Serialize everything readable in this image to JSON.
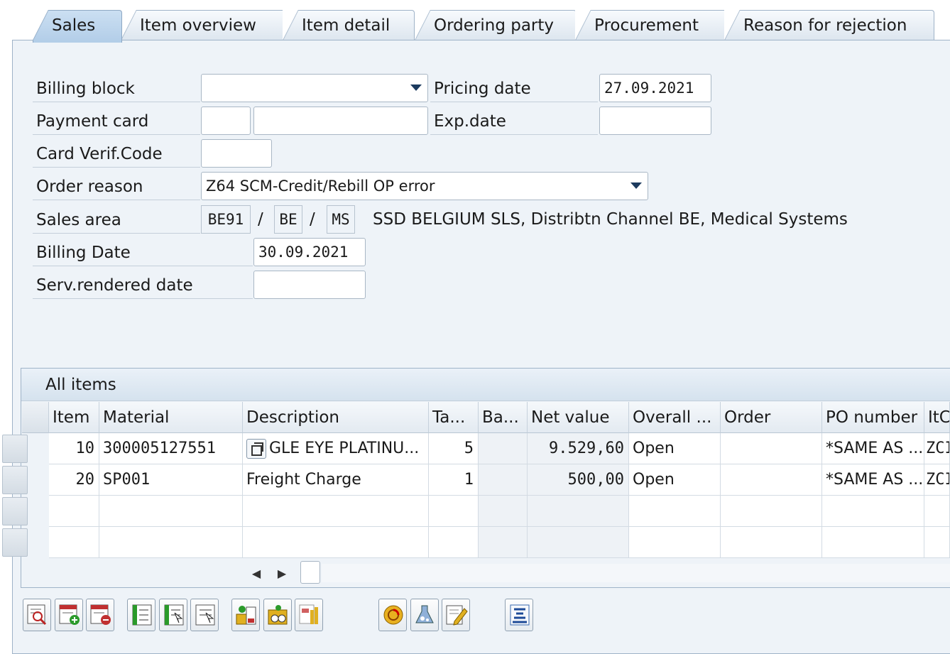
{
  "tabs": [
    {
      "label": "Sales",
      "active": true
    },
    {
      "label": "Item overview",
      "active": false
    },
    {
      "label": "Item detail",
      "active": false
    },
    {
      "label": "Ordering party",
      "active": false
    },
    {
      "label": "Procurement",
      "active": false
    },
    {
      "label": "Reason for rejection",
      "active": false
    }
  ],
  "form": {
    "billing_block_label": "Billing block",
    "billing_block_value": "",
    "pricing_date_label": "Pricing date",
    "pricing_date_value": "27.09.2021",
    "payment_card_label": "Payment card",
    "payment_card_type": "",
    "payment_card_number": "",
    "exp_date_label": "Exp.date",
    "exp_date_value": "",
    "card_verif_label": "Card Verif.Code",
    "card_verif_value": "",
    "order_reason_label": "Order reason",
    "order_reason_value": "Z64 SCM-Credit/Rebill OP error",
    "sales_area_label": "Sales area",
    "sales_org": "BE91",
    "distr_channel": "BE",
    "division": "MS",
    "slash": "/",
    "sales_area_text": "SSD BELGIUM SLS, Distribtn Channel BE, Medical Systems",
    "billing_date_label": "Billing Date",
    "billing_date_value": "30.09.2021",
    "serv_rendered_label": "Serv.rendered date",
    "serv_rendered_value": ""
  },
  "items_table": {
    "title": "All items",
    "columns": [
      "Item",
      "Material",
      "Description",
      "Ta...",
      "Ba...",
      "Net value",
      "Overall ...",
      "Order",
      "PO number",
      "ItC"
    ],
    "rows": [
      {
        "item": "10",
        "material": "300005127551",
        "description": "GLE EYE PLATINU...",
        "target_qty": "5",
        "batch": "",
        "net_value": "9.529,60",
        "overall_status": "Open",
        "order": "",
        "po_number": "*SAME AS ...",
        "item_cat": "ZCI"
      },
      {
        "item": "20",
        "material": "SP001",
        "description": "Freight Charge",
        "target_qty": "1",
        "batch": "",
        "net_value": "500,00",
        "overall_status": "Open",
        "order": "",
        "po_number": "*SAME AS ...",
        "item_cat": "ZCI"
      }
    ],
    "scroll_left": "◀",
    "scroll_right": "▶"
  },
  "toolbar": {
    "icons": [
      "details-icon",
      "insert-row-icon",
      "delete-row-icon",
      "select-all-icon",
      "select-block-icon",
      "deselect-all-icon",
      "item-conditions-icon",
      "item-config-icon",
      "structure-icon",
      "availability-icon",
      "batch-icon",
      "edit-icon",
      "sort-icon"
    ]
  },
  "colors": {
    "panel_bg": "#eef3f8",
    "tab_active": "#b2cde8",
    "border": "#9fb3c8"
  }
}
